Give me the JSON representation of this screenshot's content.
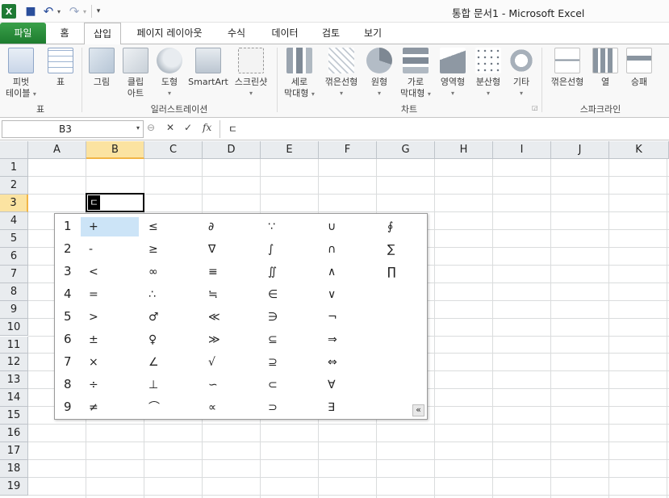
{
  "window": {
    "title": "통합 문서1  -  Microsoft Excel",
    "icons": [
      "excel-logo-icon",
      "save-icon",
      "undo-icon",
      "redo-icon",
      "customize-qat-icon"
    ]
  },
  "tabs": [
    "파일",
    "홈",
    "삽입",
    "페이지 레이아웃",
    "수식",
    "데이터",
    "검토",
    "보기"
  ],
  "active_tab": "삽입",
  "ribbon": {
    "groups": [
      {
        "label": "표",
        "buttons": [
          {
            "line1": "피벗",
            "line2": "테이블"
          },
          {
            "line1": "표",
            "line2": ""
          }
        ]
      },
      {
        "label": "일러스트레이션",
        "buttons": [
          {
            "line1": "그림",
            "line2": ""
          },
          {
            "line1": "클립",
            "line2": "아트"
          },
          {
            "line1": "도형",
            "line2": ""
          },
          {
            "line1": "SmartArt",
            "line2": ""
          },
          {
            "line1": "스크린샷",
            "line2": ""
          }
        ]
      },
      {
        "label": "차트",
        "buttons": [
          {
            "line1": "세로",
            "line2": "막대형"
          },
          {
            "line1": "꺾은선형",
            "line2": ""
          },
          {
            "line1": "원형",
            "line2": ""
          },
          {
            "line1": "가로",
            "line2": "막대형"
          },
          {
            "line1": "영역형",
            "line2": ""
          },
          {
            "line1": "분산형",
            "line2": ""
          },
          {
            "line1": "기타",
            "line2": ""
          }
        ]
      },
      {
        "label": "스파크라인",
        "buttons": [
          {
            "line1": "꺾은선형",
            "line2": ""
          },
          {
            "line1": "열",
            "line2": ""
          },
          {
            "line1": "승패",
            "line2": ""
          }
        ]
      }
    ]
  },
  "formula_bar": {
    "name_box": "B3",
    "fx": "fx",
    "cancel": "✕",
    "enter": "✓",
    "content": "ㄷ"
  },
  "grid": {
    "columns": [
      "A",
      "B",
      "C",
      "D",
      "E",
      "F",
      "G",
      "H",
      "I",
      "J",
      "K"
    ],
    "rows": [
      "1",
      "2",
      "3",
      "4",
      "5",
      "6",
      "7",
      "8",
      "9",
      "10",
      "11",
      "12",
      "13",
      "14",
      "15",
      "16",
      "17",
      "18",
      "19"
    ],
    "selected_column": "B",
    "selected_row": "3",
    "active_cell_value": "ㄷ"
  },
  "symbol_popup": {
    "row_numbers": [
      "1",
      "2",
      "3",
      "4",
      "5",
      "6",
      "7",
      "8",
      "9"
    ],
    "rows": [
      [
        "+",
        "≤",
        "∂",
        "∵",
        "∪",
        "∮"
      ],
      [
        "-",
        "≥",
        "∇",
        "∫",
        "∩",
        "∑"
      ],
      [
        "<",
        "∞",
        "≡",
        "∬",
        "∧",
        "∏"
      ],
      [
        "=",
        "∴",
        "≒",
        "∈",
        "∨",
        ""
      ],
      [
        ">",
        "♂",
        "≪",
        "∋",
        "¬",
        ""
      ],
      [
        "±",
        "♀",
        "≫",
        "⊆",
        "⇒",
        ""
      ],
      [
        "×",
        "∠",
        "√",
        "⊇",
        "⇔",
        ""
      ],
      [
        "÷",
        "⊥",
        "∽",
        "⊂",
        "∀",
        ""
      ],
      [
        "≠",
        "⌒",
        "∝",
        "⊃",
        "∃",
        ""
      ]
    ],
    "collapse": "«"
  }
}
